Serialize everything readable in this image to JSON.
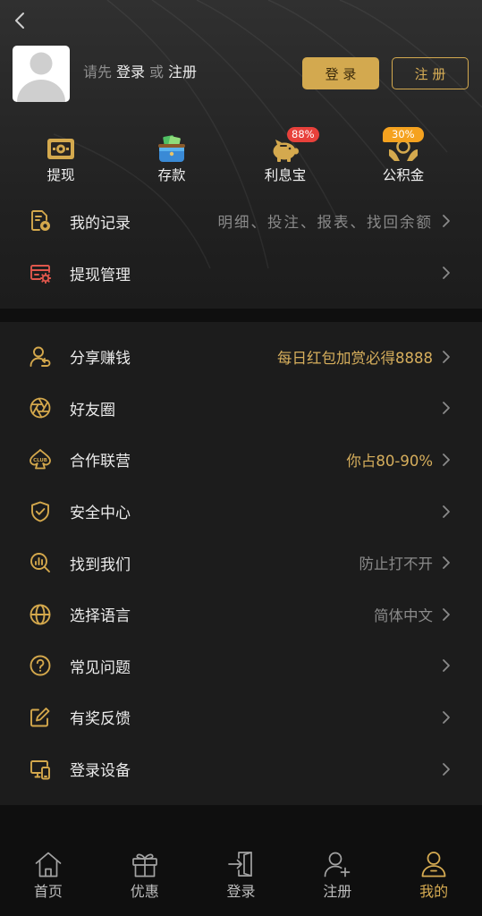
{
  "header": {
    "back_icon": "chevron-left-icon",
    "avatar_icon": "default-avatar-icon",
    "prompt": {
      "prefix": "请先",
      "login_link": "登录",
      "or": "或",
      "register_link": "注册"
    },
    "login_button": "登 录",
    "register_button": "注 册"
  },
  "quick_actions": [
    {
      "label": "提现",
      "icon": "cash-ticket-icon"
    },
    {
      "label": "存款",
      "icon": "wallet-icon"
    },
    {
      "label": "利息宝",
      "icon": "piggy-bank-icon",
      "badge": "88%",
      "badge_color": "#e8413b"
    },
    {
      "label": "公积金",
      "icon": "hands-coin-icon",
      "badge": "30%",
      "badge_color": "#f5a21f"
    }
  ],
  "menu_top": [
    {
      "label": "我的记录",
      "icon": "record-icon",
      "detail": "明细、投注、报表、找回余额",
      "detail_color": "#8a8a8a"
    },
    {
      "label": "提现管理",
      "icon": "card-gear-icon"
    }
  ],
  "menu_main": [
    {
      "label": "分享赚钱",
      "icon": "share-user-icon",
      "detail": "每日红包加赏必得8888",
      "detail_color": "#d6ae5c"
    },
    {
      "label": "好友圈",
      "icon": "aperture-icon"
    },
    {
      "label": "合作联营",
      "icon": "club-icon",
      "icon_text": "CLUB",
      "detail": "你占80-90%",
      "detail_color": "#d6ae5c"
    },
    {
      "label": "安全中心",
      "icon": "shield-check-icon"
    },
    {
      "label": "找到我们",
      "icon": "search-document-icon",
      "detail": "防止打不开",
      "detail_color": "#8a8a8a"
    },
    {
      "label": "选择语言",
      "icon": "globe-icon",
      "detail": "简体中文",
      "detail_color": "#8a8a8a"
    },
    {
      "label": "常见问题",
      "icon": "question-icon"
    },
    {
      "label": "有奖反馈",
      "icon": "feedback-edit-icon"
    },
    {
      "label": "登录设备",
      "icon": "devices-icon"
    }
  ],
  "bottom_nav": [
    {
      "label": "首页",
      "icon": "home-icon",
      "active": false
    },
    {
      "label": "优惠",
      "icon": "gift-icon",
      "active": false
    },
    {
      "label": "登录",
      "icon": "login-door-icon",
      "active": false
    },
    {
      "label": "注册",
      "icon": "add-user-icon",
      "active": false
    },
    {
      "label": "我的",
      "icon": "user-icon",
      "active": true
    }
  ],
  "colors": {
    "accent_gold": "#d4a84c",
    "text_primary": "#ebebeb",
    "text_muted": "#8a8a8a",
    "danger_icon": "#e0574c",
    "nav_inactive": "#a3a3a3"
  }
}
